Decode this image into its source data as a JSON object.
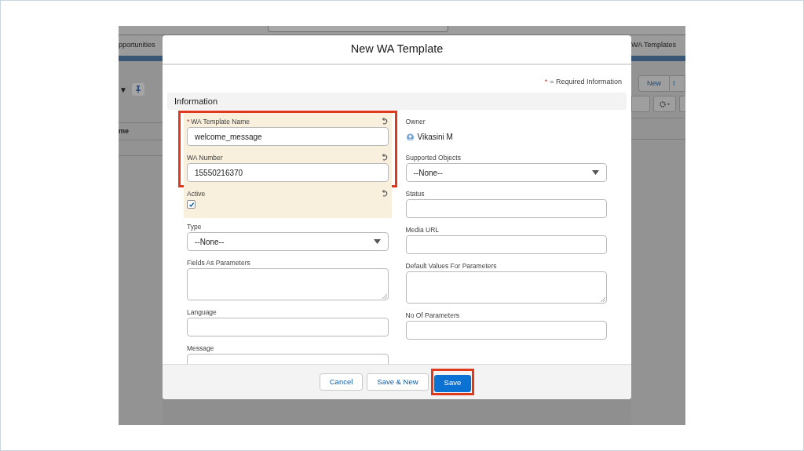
{
  "background": {
    "left_tab": "pportunities",
    "left_column_header": "me",
    "dropdown_glyph": "▼",
    "right_tab": "WA Templates",
    "new_button": "New",
    "cut_button": "I"
  },
  "modal": {
    "title": "New WA Template",
    "required_note": "= Required Information",
    "required_mark": "*",
    "section": "Information",
    "left_column": [
      {
        "kind": "text",
        "label": "WA Template Name",
        "value": "welcome_message",
        "required": true,
        "edited": true,
        "annotated": true
      },
      {
        "kind": "text",
        "label": "WA Number",
        "value": "15550216370",
        "required": false,
        "edited": true,
        "annotated": true
      },
      {
        "kind": "checkbox",
        "label": "Active",
        "checked": true,
        "required": false,
        "edited": true,
        "annotated": false
      },
      {
        "kind": "select",
        "label": "Type",
        "value": "--None--",
        "required": false,
        "edited": false,
        "annotated": false
      },
      {
        "kind": "textarea",
        "label": "Fields As Parameters",
        "required": false,
        "edited": false,
        "annotated": false
      },
      {
        "kind": "text",
        "label": "Language",
        "required": false,
        "edited": false,
        "annotated": false
      },
      {
        "kind": "textarea",
        "label": "Message",
        "required": false,
        "edited": false,
        "annotated": false
      }
    ],
    "right_column": [
      {
        "kind": "owner",
        "label": "Owner",
        "value": "Vikasini M",
        "required": false,
        "edited": false,
        "annotated": false
      },
      {
        "kind": "select",
        "label": "Supported Objects",
        "value": "--None--",
        "required": false,
        "edited": false,
        "annotated": false
      },
      {
        "kind": "text",
        "label": "Status",
        "required": false,
        "edited": false,
        "annotated": false
      },
      {
        "kind": "text",
        "label": "Media URL",
        "required": false,
        "edited": false,
        "annotated": false
      },
      {
        "kind": "textarea",
        "label": "Default Values For Parameters",
        "required": false,
        "edited": false,
        "annotated": false
      },
      {
        "kind": "text",
        "label": "No Of Parameters",
        "required": false,
        "edited": false,
        "annotated": false
      }
    ],
    "buttons": [
      {
        "label": "Cancel",
        "primary": false,
        "annotated": false
      },
      {
        "label": "Save & New",
        "primary": false,
        "annotated": false
      },
      {
        "label": "Save",
        "primary": true,
        "annotated": true
      }
    ]
  }
}
